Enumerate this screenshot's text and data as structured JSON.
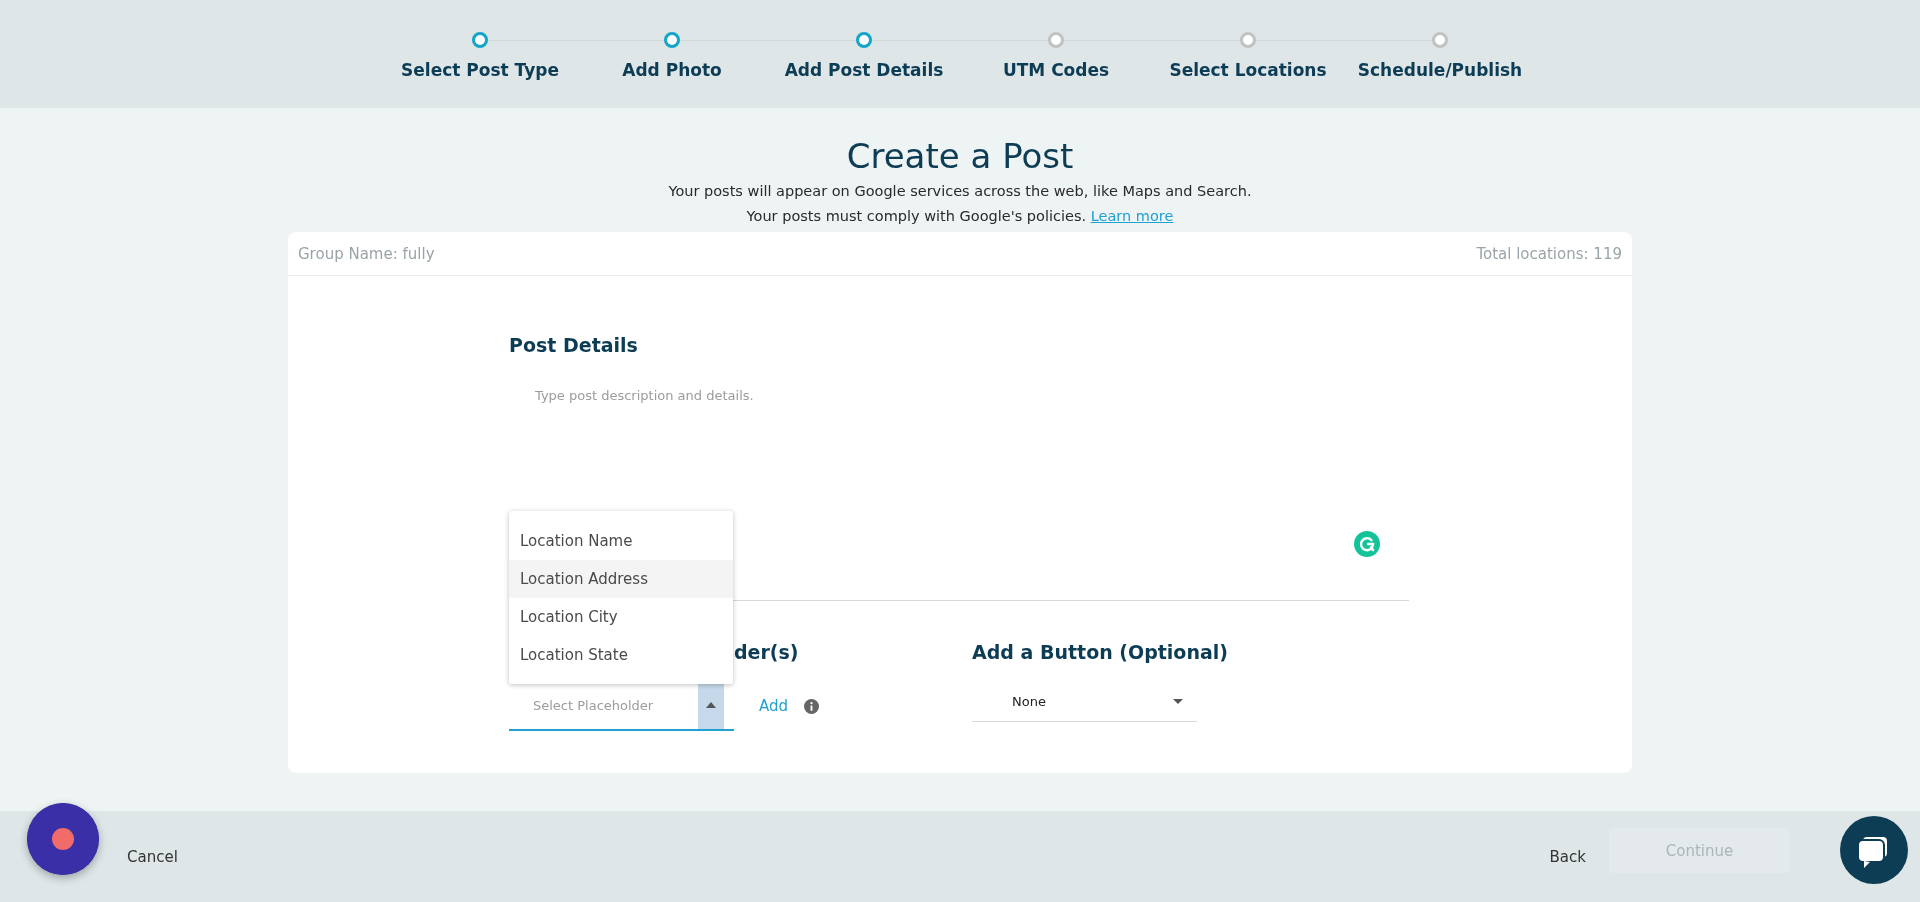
{
  "stepper": {
    "steps": [
      {
        "label": "Select Post Type",
        "completed": true
      },
      {
        "label": "Add Photo",
        "completed": true
      },
      {
        "label": "Add Post Details",
        "completed": true
      },
      {
        "label": "UTM Codes",
        "completed": false
      },
      {
        "label": "Select Locations",
        "completed": false
      },
      {
        "label": "Schedule/Publish",
        "completed": false
      }
    ]
  },
  "header": {
    "title": "Create a Post",
    "lines": [
      "Your posts will appear on Google services across the web, like Maps and Search.",
      "Your posts must comply with Google's policies."
    ],
    "link": "Learn more"
  },
  "card": {
    "group_name": "Group Name: fully",
    "total_locations": "Total locations: 119"
  },
  "post_details": {
    "heading": "Post Details",
    "placeholder": "Type post description and details."
  },
  "placeholders": {
    "heading": "der(s)",
    "select_placeholder": "Select Placeholder",
    "expanded": true,
    "add_link": "Add",
    "menu": [
      {
        "label": "Location Name",
        "selected": false
      },
      {
        "label": "Location Address",
        "selected": true
      },
      {
        "label": "Location City",
        "selected": false
      },
      {
        "label": "Location State",
        "selected": false
      }
    ]
  },
  "button_section": {
    "heading": "Add a Button (Optional)",
    "value": "None"
  },
  "footer": {
    "cancel": "Cancel",
    "back": "Back",
    "continue": {
      "label": "Continue",
      "disabled": true
    }
  }
}
